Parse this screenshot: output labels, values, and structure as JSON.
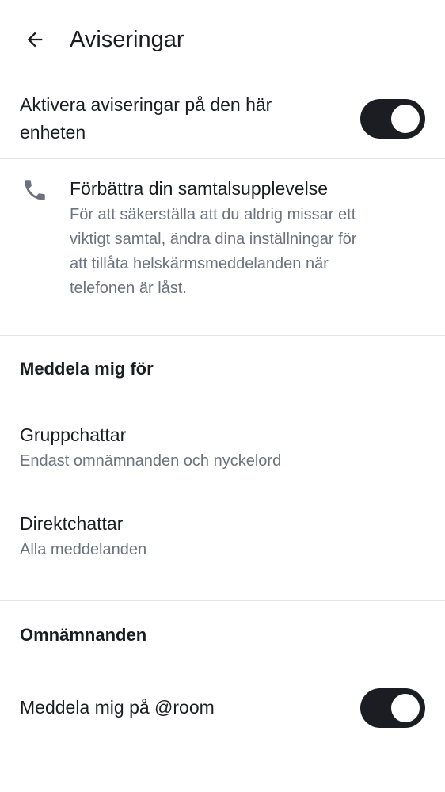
{
  "header": {
    "title": "Aviseringar"
  },
  "enable_notifications": {
    "label_line1": "Aktivera aviseringar på den här",
    "label_line2": "enheten",
    "enabled": true
  },
  "call_banner": {
    "icon": "phone-icon",
    "title": "Förbättra din samtalsupplevelse",
    "desc_lines": [
      "För att säkerställa att du aldrig missar ett",
      "viktigt samtal, ändra dina inställningar för",
      "att tillåta helskärmsmeddelanden när",
      "telefonen är låst."
    ]
  },
  "notify_me_for": {
    "header": "Meddela mig för",
    "items": [
      {
        "title": "Gruppchattar",
        "subtitle": "Endast omnämnanden och nyckelord"
      },
      {
        "title": "Direktchattar",
        "subtitle": "Alla meddelanden"
      }
    ]
  },
  "mentions": {
    "header": "Omnämnanden",
    "room_label": "Meddela mig på @room",
    "room_enabled": true
  },
  "colors": {
    "text_primary": "#1b1d22",
    "text_secondary": "#6c737e",
    "divider": "#e3e5e8",
    "toggle_on": "#1b1d22",
    "background": "#ffffff"
  }
}
